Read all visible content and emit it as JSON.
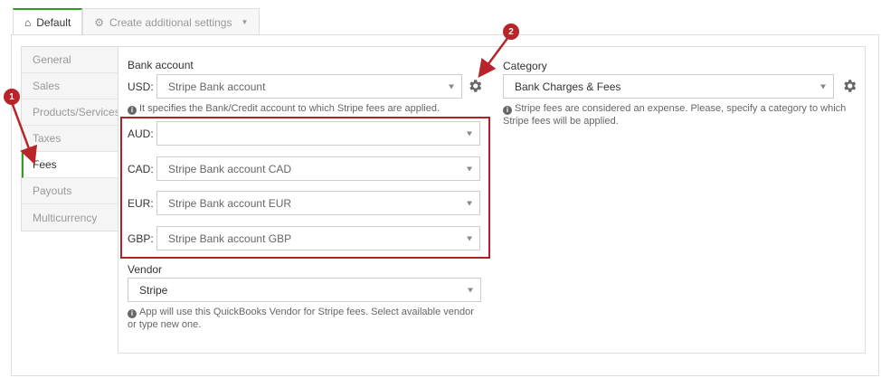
{
  "tabs": {
    "default_label": "Default",
    "create_label": "Create additional settings"
  },
  "sidebar": {
    "items": [
      {
        "label": "General"
      },
      {
        "label": "Sales"
      },
      {
        "label": "Products/Services"
      },
      {
        "label": "Taxes"
      },
      {
        "label": "Fees"
      },
      {
        "label": "Payouts"
      },
      {
        "label": "Multicurrency"
      }
    ],
    "active": "Fees"
  },
  "bank_account": {
    "heading": "Bank account",
    "usd_label": "USD:",
    "usd_value": "Stripe Bank account",
    "help": "It specifies the Bank/Credit account to which Stripe fees are applied.",
    "currencies": [
      {
        "label": "AUD:",
        "value": ""
      },
      {
        "label": "CAD:",
        "value": "Stripe Bank account CAD"
      },
      {
        "label": "EUR:",
        "value": "Stripe Bank account EUR"
      },
      {
        "label": "GBP:",
        "value": "Stripe Bank account GBP"
      }
    ]
  },
  "vendor": {
    "heading": "Vendor",
    "value": "Stripe",
    "help": "App will use this QuickBooks Vendor for Stripe fees. Select available vendor or type new one."
  },
  "category": {
    "heading": "Category",
    "value": "Bank Charges & Fees",
    "help": "Stripe fees are considered an expense. Please, specify a category to which Stripe fees will be applied."
  },
  "annotations": {
    "badge1": "1",
    "badge2": "2",
    "color": "#b8242a"
  },
  "colors": {
    "accent": "#2ca01c",
    "highlight_border": "#b21f24"
  }
}
